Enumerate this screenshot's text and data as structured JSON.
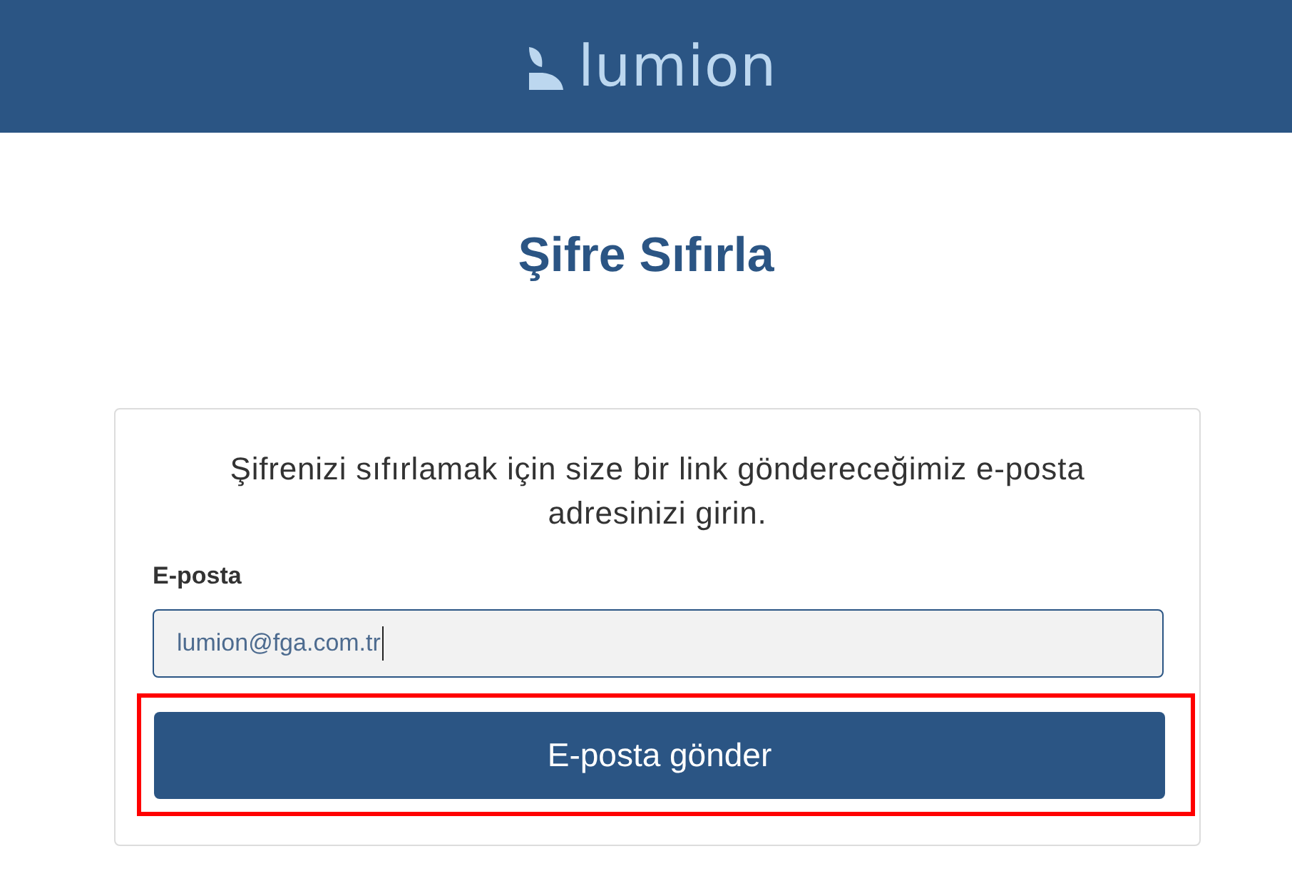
{
  "header": {
    "logo_text": "lumion"
  },
  "title": "Şifre Sıfırla",
  "form": {
    "description": "Şifrenizi sıfırlamak için size bir link göndereceğimiz e-posta adresinizi girin.",
    "email_field": {
      "label": "E-posta",
      "value": "lumion@fga.com.tr",
      "focused": true
    },
    "submit_button": {
      "label": "E-posta gönder",
      "highlighted": true
    }
  }
}
